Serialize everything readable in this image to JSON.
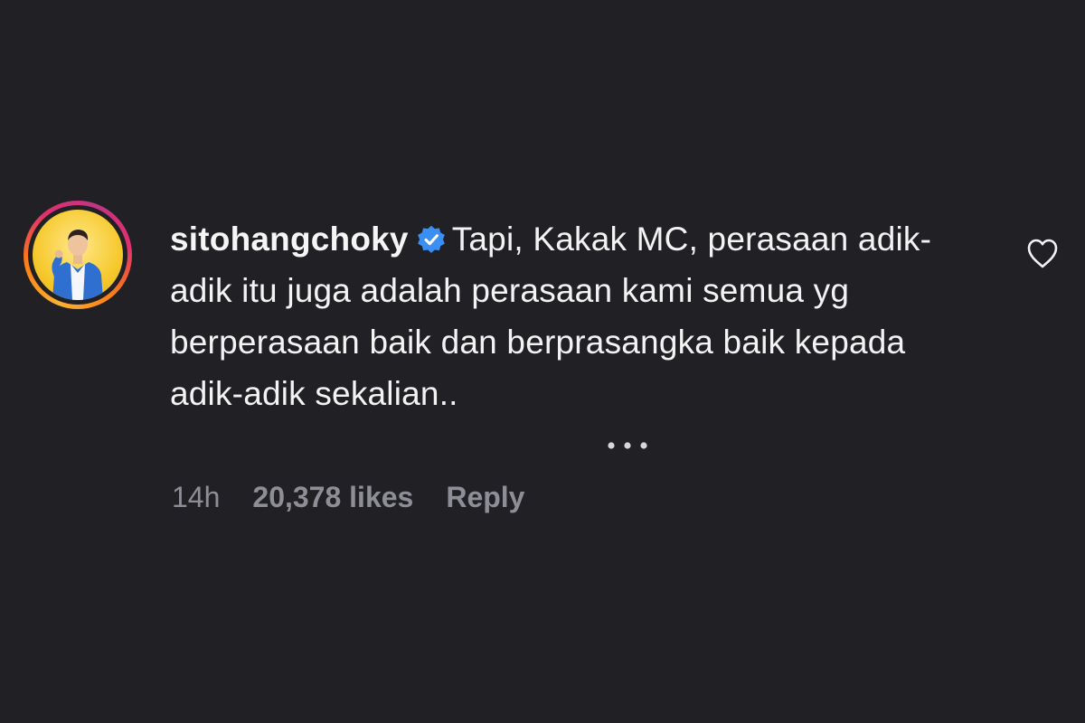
{
  "comment": {
    "username": "sitohangchoky",
    "verified": true,
    "text": "Tapi, Kakak MC, perasaan adik-adik itu juga adalah perasaan kami semua yg berperasaan baik dan berprasangka baik kepada adik-adik sekalian..",
    "time": "14h",
    "likes": "20,378 likes",
    "reply_label": "Reply",
    "icons": {
      "avatar": "profile-avatar",
      "verified": "verified-badge-icon",
      "like": "heart-outline-icon",
      "more": "more-dots-icon"
    },
    "colors": {
      "background": "#212125",
      "text": "#f3f3f3",
      "meta": "#8e8e96",
      "verified": "#3a8ff5"
    }
  }
}
